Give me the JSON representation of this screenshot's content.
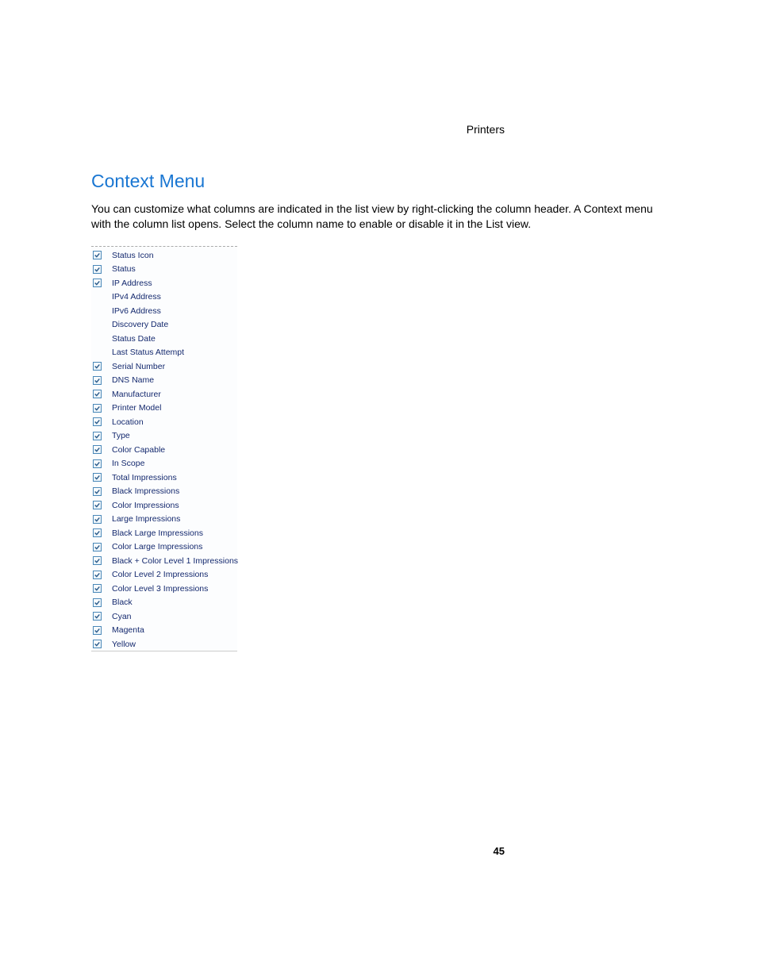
{
  "header": {
    "section": "Printers"
  },
  "heading": "Context Menu",
  "body": "You can customize what columns are indicated in the list view by right-clicking the column header. A Context menu with the column list opens. Select the column name to enable or disable it in the List view.",
  "menu_items": [
    {
      "label": "Status Icon",
      "checked": true
    },
    {
      "label": "Status",
      "checked": true
    },
    {
      "label": "IP Address",
      "checked": true
    },
    {
      "label": "IPv4 Address",
      "checked": false
    },
    {
      "label": "IPv6 Address",
      "checked": false
    },
    {
      "label": "Discovery Date",
      "checked": false
    },
    {
      "label": "Status Date",
      "checked": false
    },
    {
      "label": "Last Status Attempt",
      "checked": false
    },
    {
      "label": "Serial Number",
      "checked": true
    },
    {
      "label": "DNS Name",
      "checked": true
    },
    {
      "label": "Manufacturer",
      "checked": true
    },
    {
      "label": "Printer Model",
      "checked": true
    },
    {
      "label": "Location",
      "checked": true
    },
    {
      "label": "Type",
      "checked": true
    },
    {
      "label": "Color Capable",
      "checked": true
    },
    {
      "label": "In Scope",
      "checked": true
    },
    {
      "label": "Total Impressions",
      "checked": true
    },
    {
      "label": "Black Impressions",
      "checked": true
    },
    {
      "label": "Color Impressions",
      "checked": true
    },
    {
      "label": "Large Impressions",
      "checked": true
    },
    {
      "label": "Black Large Impressions",
      "checked": true
    },
    {
      "label": "Color Large Impressions",
      "checked": true
    },
    {
      "label": "Black + Color Level 1 Impressions",
      "checked": true
    },
    {
      "label": "Color Level 2 Impressions",
      "checked": true
    },
    {
      "label": "Color Level 3 Impressions",
      "checked": true
    },
    {
      "label": "Black",
      "checked": true
    },
    {
      "label": "Cyan",
      "checked": true
    },
    {
      "label": "Magenta",
      "checked": true
    },
    {
      "label": "Yellow",
      "checked": true
    }
  ],
  "page_number": "45"
}
